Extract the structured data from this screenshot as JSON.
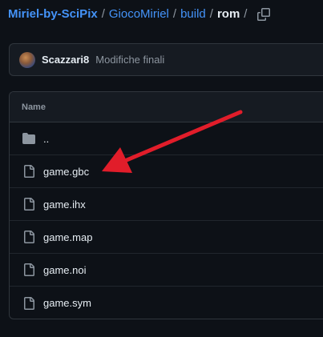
{
  "breadcrumb": {
    "repo": "Miriel-by-SciPix",
    "folder1": "GiocoMiriel",
    "folder2": "build",
    "current": "rom",
    "separator": "/"
  },
  "commit": {
    "author": "Scazzari8",
    "message": "Modifiche finali"
  },
  "table": {
    "header": "Name",
    "rows": [
      {
        "name": "..",
        "icon": "folder-icon"
      },
      {
        "name": "game.gbc",
        "icon": "file-icon"
      },
      {
        "name": "game.ihx",
        "icon": "file-icon"
      },
      {
        "name": "game.map",
        "icon": "file-icon"
      },
      {
        "name": "game.noi",
        "icon": "file-icon"
      },
      {
        "name": "game.sym",
        "icon": "file-icon"
      }
    ]
  },
  "colors": {
    "link": "#4493f8",
    "annotation_arrow": "#e11d2a"
  }
}
